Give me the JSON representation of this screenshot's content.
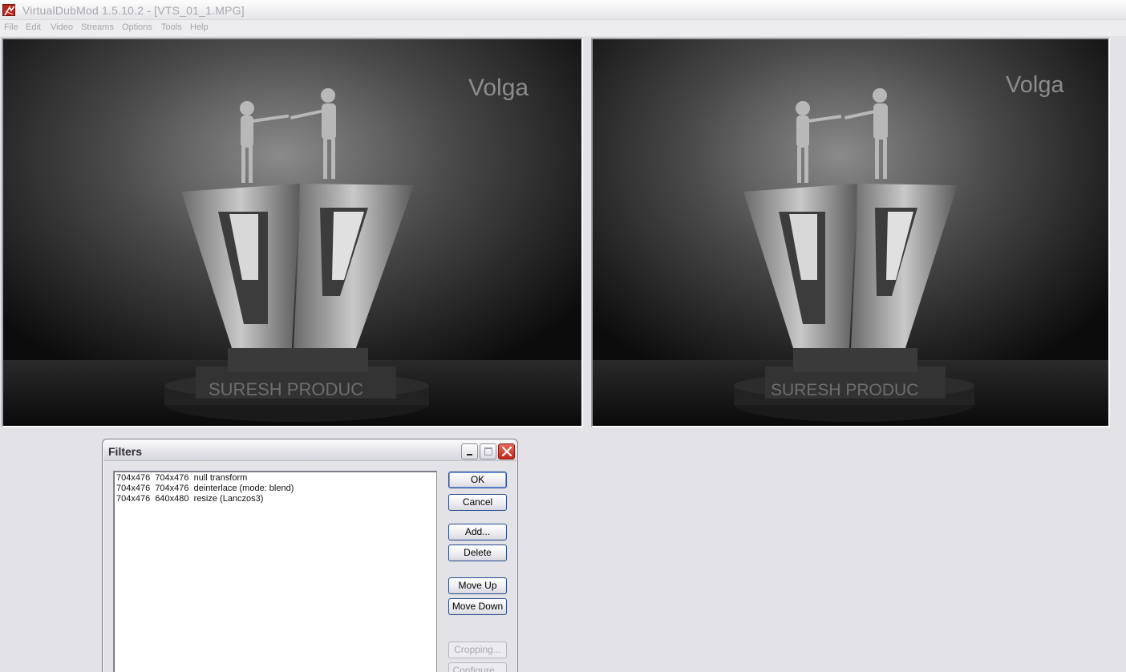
{
  "window": {
    "title": "VirtualDubMod 1.5.10.2 - [VTS_01_1.MPG]",
    "icon": "virtualdub-app-icon"
  },
  "menubar": {
    "items": [
      "File",
      "Edit",
      "Video",
      "Streams",
      "Options",
      "Tools",
      "Help"
    ]
  },
  "panes": {
    "input": {
      "logo_text": "Volga",
      "banner_text": "SURESH PRODUC"
    },
    "output": {
      "logo_text": "Volga",
      "banner_text": "SURESH PRODUC"
    }
  },
  "filters_dialog": {
    "title": "Filters",
    "filters": [
      "704x476  704x476  null transform",
      "704x476  704x476  deinterlace (mode: blend)",
      "704x476  640x480  resize (Lanczos3)"
    ],
    "buttons": {
      "ok": "OK",
      "cancel": "Cancel",
      "add": "Add...",
      "delete": "Delete",
      "move_up": "Move Up",
      "move_down": "Move Down",
      "cropping": "Cropping...",
      "configure": "Configure..."
    }
  }
}
